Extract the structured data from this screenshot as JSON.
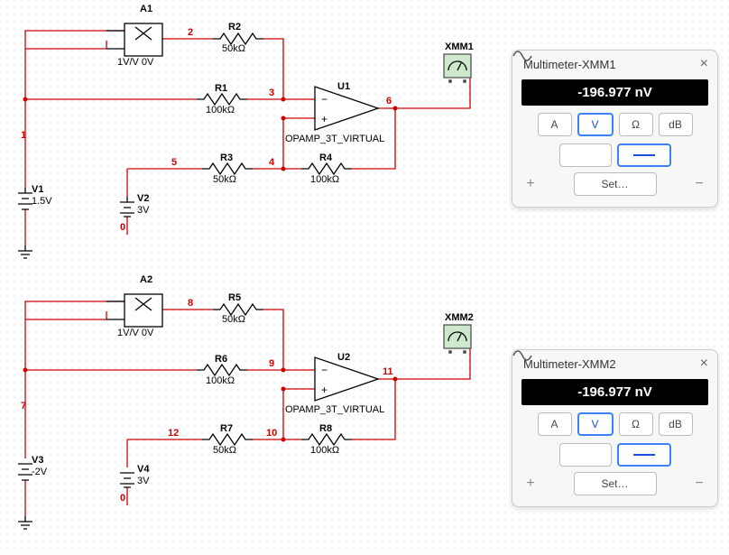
{
  "circuit1": {
    "multiplier": {
      "name": "A1",
      "sub": "1V/V 0V"
    },
    "r2": {
      "name": "R2",
      "val": "50kΩ"
    },
    "r1": {
      "name": "R1",
      "val": "100kΩ"
    },
    "r3": {
      "name": "R3",
      "val": "50kΩ"
    },
    "r4": {
      "name": "R4",
      "val": "100kΩ"
    },
    "u1": {
      "name": "U1",
      "type": "OPAMP_3T_VIRTUAL"
    },
    "v1": {
      "name": "V1",
      "val": "1.5V"
    },
    "v2": {
      "name": "V2",
      "val": "3V"
    },
    "meter": "XMM1",
    "nodes": {
      "n1": "1",
      "n2": "2",
      "n3": "3",
      "n4": "4",
      "n5": "5",
      "n6": "6",
      "n0": "0"
    }
  },
  "circuit2": {
    "multiplier": {
      "name": "A2",
      "sub": "1V/V 0V"
    },
    "r5": {
      "name": "R5",
      "val": "50kΩ"
    },
    "r6": {
      "name": "R6",
      "val": "100kΩ"
    },
    "r7": {
      "name": "R7",
      "val": "50kΩ"
    },
    "r8": {
      "name": "R8",
      "val": "100kΩ"
    },
    "u2": {
      "name": "U2",
      "type": "OPAMP_3T_VIRTUAL"
    },
    "v3": {
      "name": "V3",
      "val": "-2V"
    },
    "v4": {
      "name": "V4",
      "val": "3V"
    },
    "meter": "XMM2",
    "nodes": {
      "n7": "7",
      "n8": "8",
      "n9": "9",
      "n10": "10",
      "n11": "11",
      "n12": "12",
      "n0": "0"
    }
  },
  "panel1": {
    "title": "Multimeter-XMM1",
    "reading": "-196.977 nV",
    "btn_a": "A",
    "btn_v": "V",
    "btn_ohm": "Ω",
    "btn_db": "dB",
    "set": "Set…"
  },
  "panel2": {
    "title": "Multimeter-XMM2",
    "reading": "-196.977 nV",
    "btn_a": "A",
    "btn_v": "V",
    "btn_ohm": "Ω",
    "btn_db": "dB",
    "set": "Set…"
  }
}
